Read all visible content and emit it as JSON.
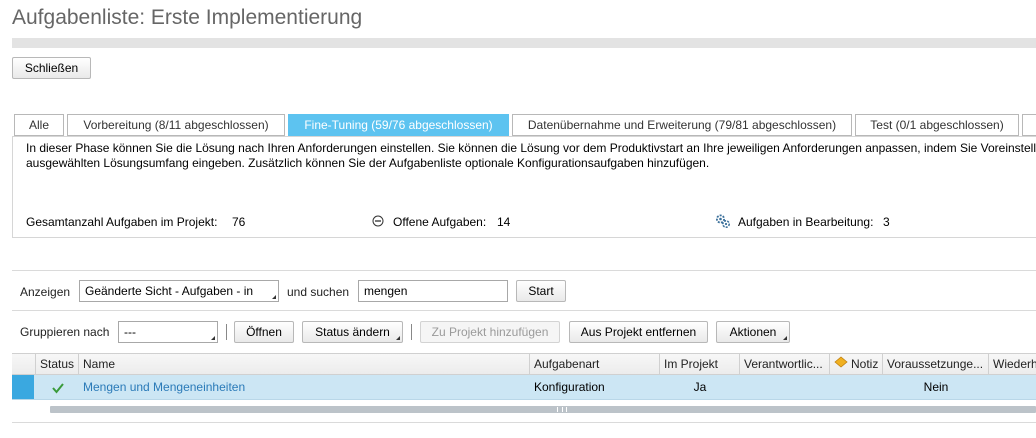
{
  "header": {
    "title": "Aufgabenliste: Erste Implementierung"
  },
  "toolbar": {
    "close_label": "Schließen"
  },
  "tabs": [
    {
      "label": "Alle",
      "active": false
    },
    {
      "label": "Vorbereitung (8/11 abgeschlossen)",
      "active": false
    },
    {
      "label": "Fine-Tuning (59/76 abgeschlossen)",
      "active": true
    },
    {
      "label": "Datenübernahme und Erweiterung (79/81 abgeschlossen)",
      "active": false
    },
    {
      "label": "Test (0/1 abgeschlossen)",
      "active": false
    }
  ],
  "phase": {
    "description_line1": "In dieser Phase können Sie die Lösung nach Ihren Anforderungen einstellen. Sie können die Lösung vor dem Produktivstart an Ihre jeweiligen Anforderungen anpassen, indem Sie Voreinstell",
    "description_line2": "ausgewählten Lösungsumfang eingeben. Zusätzlich können Sie der Aufgabenliste optionale Konfigurationsaufgaben hinzufügen.",
    "total_label": "Gesamtanzahl Aufgaben im Projekt:",
    "total_value": "76",
    "open_label": "Offene Aufgaben:",
    "open_value": "14",
    "inprogress_label": "Aufgaben in Bearbeitung:",
    "inprogress_value": "3"
  },
  "filter": {
    "show_label": "Anzeigen",
    "view_value": "Geänderte Sicht - Aufgaben - in",
    "search_label": "und suchen",
    "search_value": "mengen",
    "start_label": "Start"
  },
  "actions": {
    "group_label": "Gruppieren nach",
    "group_value": "---",
    "open_label": "Öffnen",
    "status_label": "Status ändern",
    "add_label": "Zu Projekt hinzufügen",
    "remove_label": "Aus Projekt entfernen",
    "actions_label": "Aktionen"
  },
  "table": {
    "columns": [
      "Status",
      "Name",
      "Aufgabenart",
      "Im Projekt",
      "Verantwortlic...",
      "Notiz",
      "Voraussetzunge...",
      "Wiederh"
    ],
    "rows": [
      {
        "status_icon": "check-icon",
        "name": "Mengen und Mengeneinheiten",
        "type": "Konfiguration",
        "in_project": "Ja",
        "responsible": "",
        "note": "",
        "prerequisite": "Nein",
        "repeat": ""
      }
    ]
  },
  "colors": {
    "accent": "#5dc3f0",
    "link": "#2a7ab8",
    "row_selected": "#cce6f4",
    "check": "#3a9a3a",
    "note_icon": "#f0b020"
  }
}
